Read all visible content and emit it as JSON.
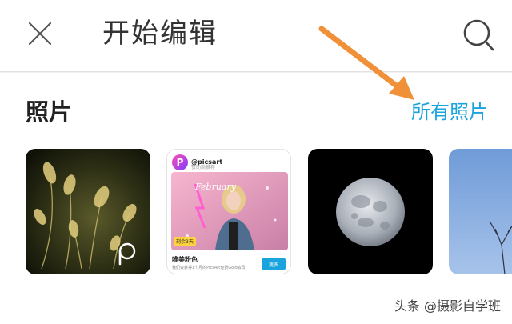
{
  "header": {
    "title": "开始编辑",
    "close_icon": "close-icon",
    "search_icon": "search-icon"
  },
  "section": {
    "title": "照片",
    "all_photos_label": "所有照片"
  },
  "colors": {
    "accent": "#1aa3dc",
    "annotation_arrow": "#f0913a"
  },
  "thumbnails": [
    {
      "name": "plant-photo",
      "badge_icon": "picsart-p-icon"
    },
    {
      "name": "picsart-ad-card",
      "handle": "@picsart",
      "subtitle": "赞助商推荐",
      "image_text": "February",
      "badge": "剩余3天",
      "caption": "唯美粉色",
      "description": "我们会获得1个月的PicsArt免费Gold会员",
      "button_label": "更多"
    },
    {
      "name": "moon-photo"
    },
    {
      "name": "sky-photo"
    }
  ],
  "watermark": "头条 @摄影自学班"
}
